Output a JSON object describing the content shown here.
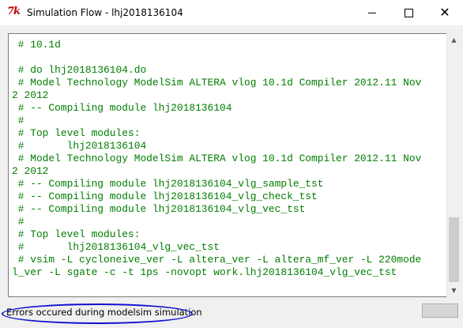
{
  "window": {
    "title": "Simulation Flow - lhj2018136104",
    "icon": "tk-feather-icon",
    "controls": [
      "minimize-icon",
      "maximize-icon",
      "close-icon"
    ]
  },
  "console": {
    "text_color": "#007d00",
    "lines": [
      " # 10.1d",
      "",
      " # do lhj2018136104.do",
      " # Model Technology ModelSim ALTERA vlog 10.1d Compiler 2012.11 Nov",
      "2 2012",
      " # -- Compiling module lhj2018136104",
      " #",
      " # Top level modules:",
      " #       lhj2018136104",
      " # Model Technology ModelSim ALTERA vlog 10.1d Compiler 2012.11 Nov",
      "2 2012",
      " # -- Compiling module lhj2018136104_vlg_sample_tst",
      " # -- Compiling module lhj2018136104_vlg_check_tst",
      " # -- Compiling module lhj2018136104_vlg_vec_tst",
      " #",
      " # Top level modules:",
      " #       lhj2018136104_vlg_vec_tst",
      " # vsim -L cycloneive_ver -L altera_ver -L altera_mf_ver -L 220mode",
      "l_ver -L sgate -c -t 1ps -novopt work.lhj2018136104_vlg_vec_tst"
    ]
  },
  "status": {
    "message": "Errors occured during modelsim simulation",
    "highlight_color": "#1010d0"
  }
}
